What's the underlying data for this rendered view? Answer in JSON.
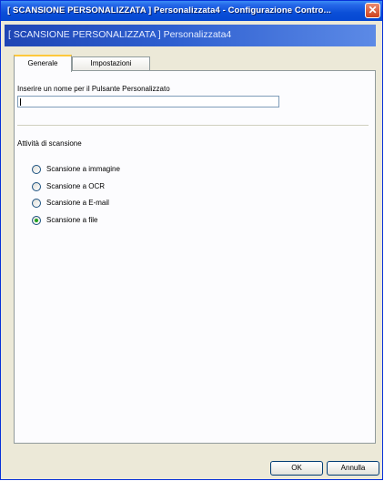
{
  "window": {
    "title": "[ SCANSIONE PERSONALIZZATA ]  Personalizzata4 - Configurazione Contro...",
    "close_glyph": "✕"
  },
  "header": {
    "text": "[ SCANSIONE PERSONALIZZATA ]  Personalizzata4"
  },
  "tabs": [
    {
      "label": "Generale",
      "active": true
    },
    {
      "label": "Impostazioni",
      "active": false
    }
  ],
  "name_field": {
    "label": "Inserire un nome per il Pulsante Personalizzato",
    "value": ""
  },
  "scan_activity": {
    "label": "Attività di scansione",
    "options": [
      {
        "label": "Scansione a immagine",
        "selected": false
      },
      {
        "label": "Scansione a OCR",
        "selected": false
      },
      {
        "label": "Scansione a E-mail",
        "selected": false
      },
      {
        "label": "Scansione a file",
        "selected": true
      }
    ]
  },
  "buttons": {
    "ok": "OK",
    "cancel": "Annulla"
  }
}
